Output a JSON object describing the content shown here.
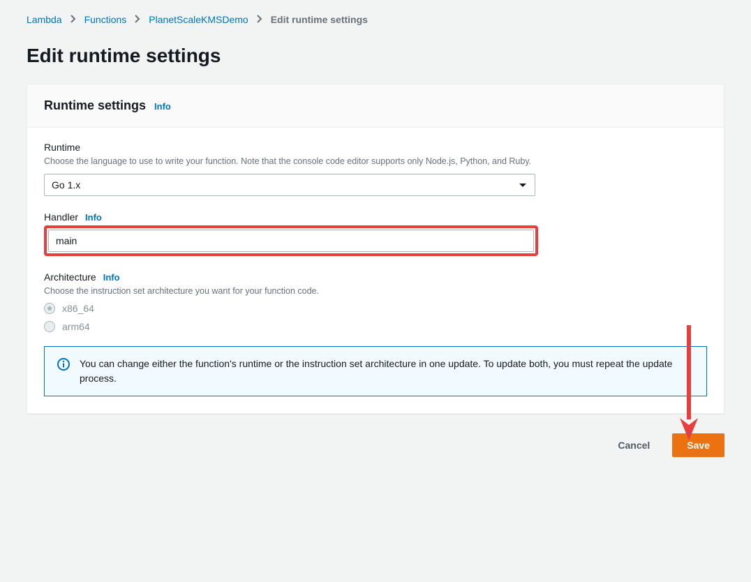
{
  "breadcrumb": {
    "items": [
      {
        "label": "Lambda"
      },
      {
        "label": "Functions"
      },
      {
        "label": "PlanetScaleKMSDemo"
      }
    ],
    "current": "Edit runtime settings"
  },
  "page": {
    "title": "Edit runtime settings"
  },
  "panel": {
    "title": "Runtime settings",
    "info": "Info"
  },
  "runtime": {
    "label": "Runtime",
    "description": "Choose the language to use to write your function. Note that the console code editor supports only Node.js, Python, and Ruby.",
    "value": "Go 1.x"
  },
  "handler": {
    "label": "Handler",
    "info": "Info",
    "value": "main"
  },
  "architecture": {
    "label": "Architecture",
    "info": "Info",
    "description": "Choose the instruction set architecture you want for your function code.",
    "options": [
      {
        "label": "x86_64",
        "selected": true
      },
      {
        "label": "arm64",
        "selected": false
      }
    ]
  },
  "infoBox": {
    "text": "You can change either the function's runtime or the instruction set architecture in one update. To update both, you must repeat the update process."
  },
  "actions": {
    "cancel": "Cancel",
    "save": "Save"
  }
}
